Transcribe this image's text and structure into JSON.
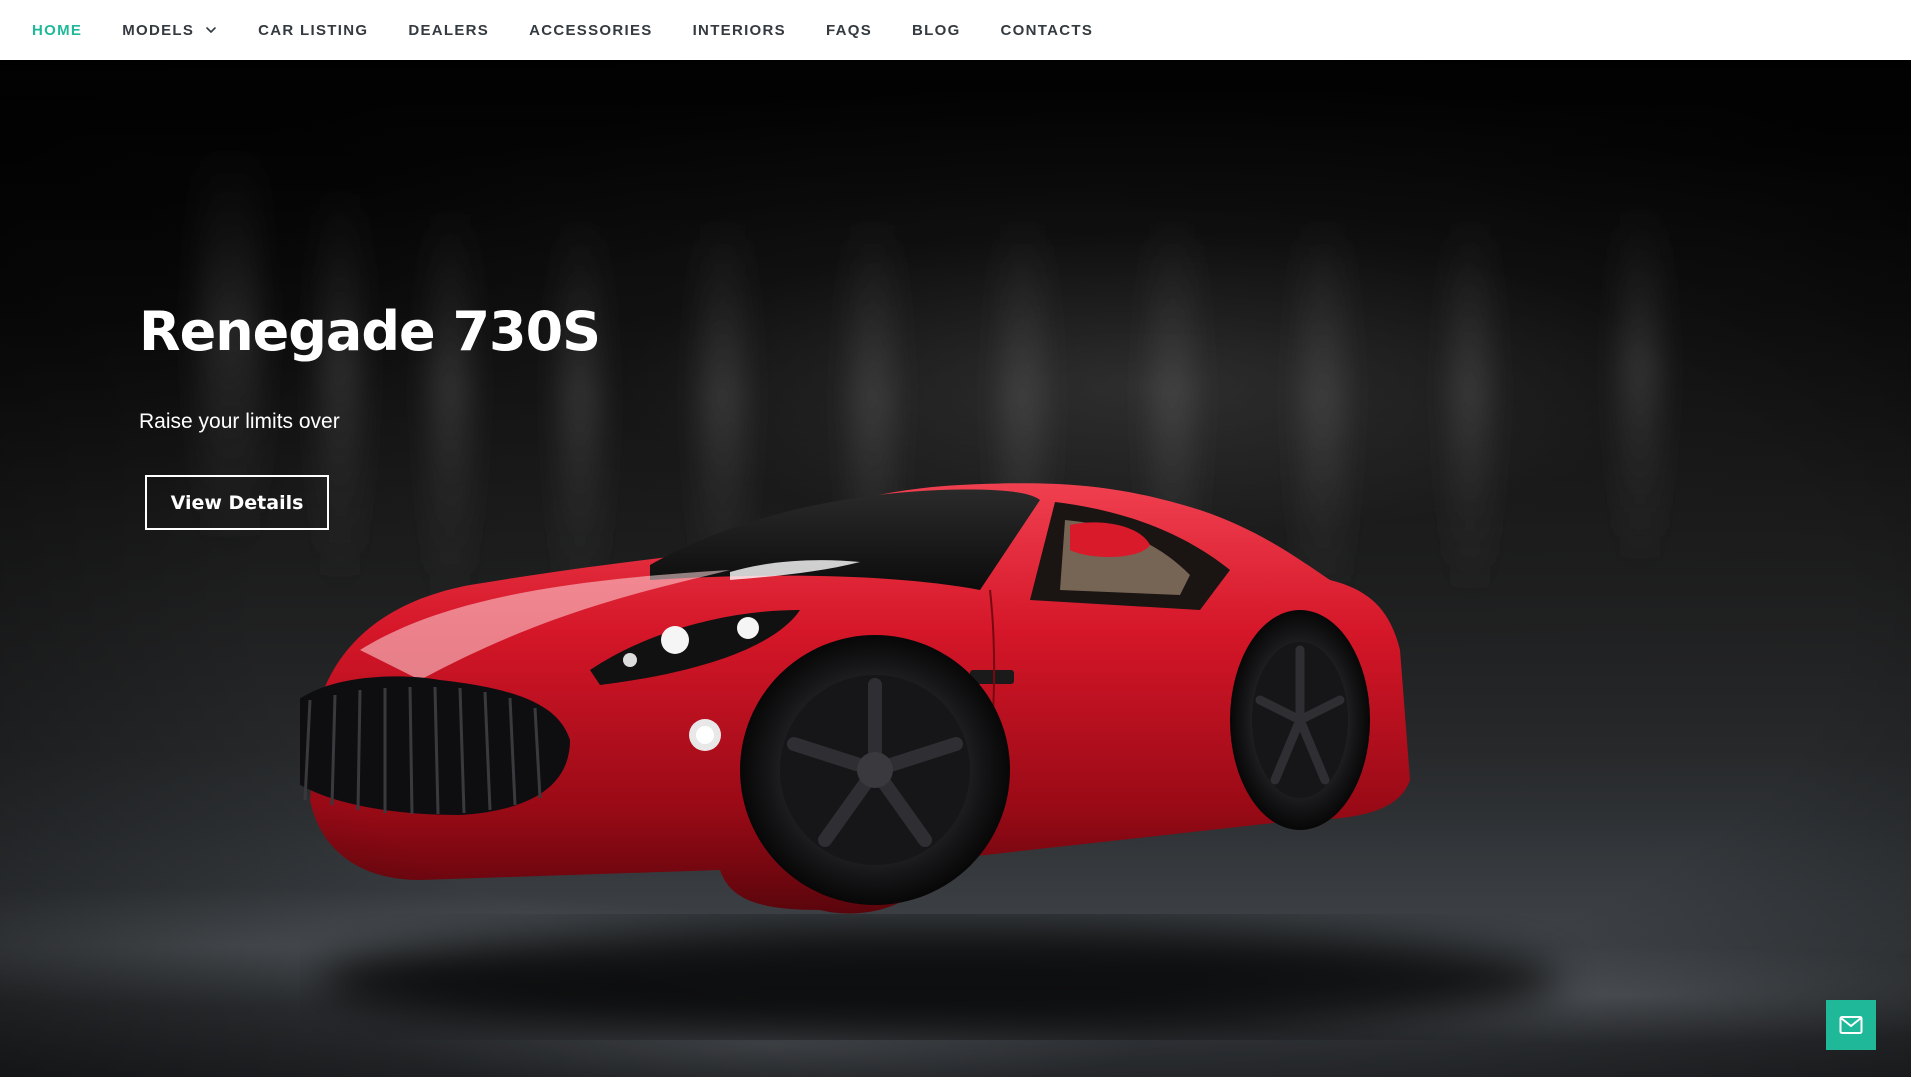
{
  "nav": {
    "items": [
      {
        "label": "HOME",
        "active": true
      },
      {
        "label": "MODELS",
        "has_dropdown": true
      },
      {
        "label": "CAR LISTING"
      },
      {
        "label": "DEALERS"
      },
      {
        "label": "ACCESSORIES"
      },
      {
        "label": "INTERIORS"
      },
      {
        "label": "FAQS"
      },
      {
        "label": "BLOG"
      },
      {
        "label": "CONTACTS"
      }
    ],
    "active_color": "#1fb99a",
    "text_color": "#333a40"
  },
  "hero": {
    "title": "Renegade 730S",
    "subtitle": "Raise your limits over",
    "button_label": "View Details",
    "car_color": "#c5101f"
  },
  "floating": {
    "icon": "mail-icon",
    "color": "#1fb99a"
  }
}
